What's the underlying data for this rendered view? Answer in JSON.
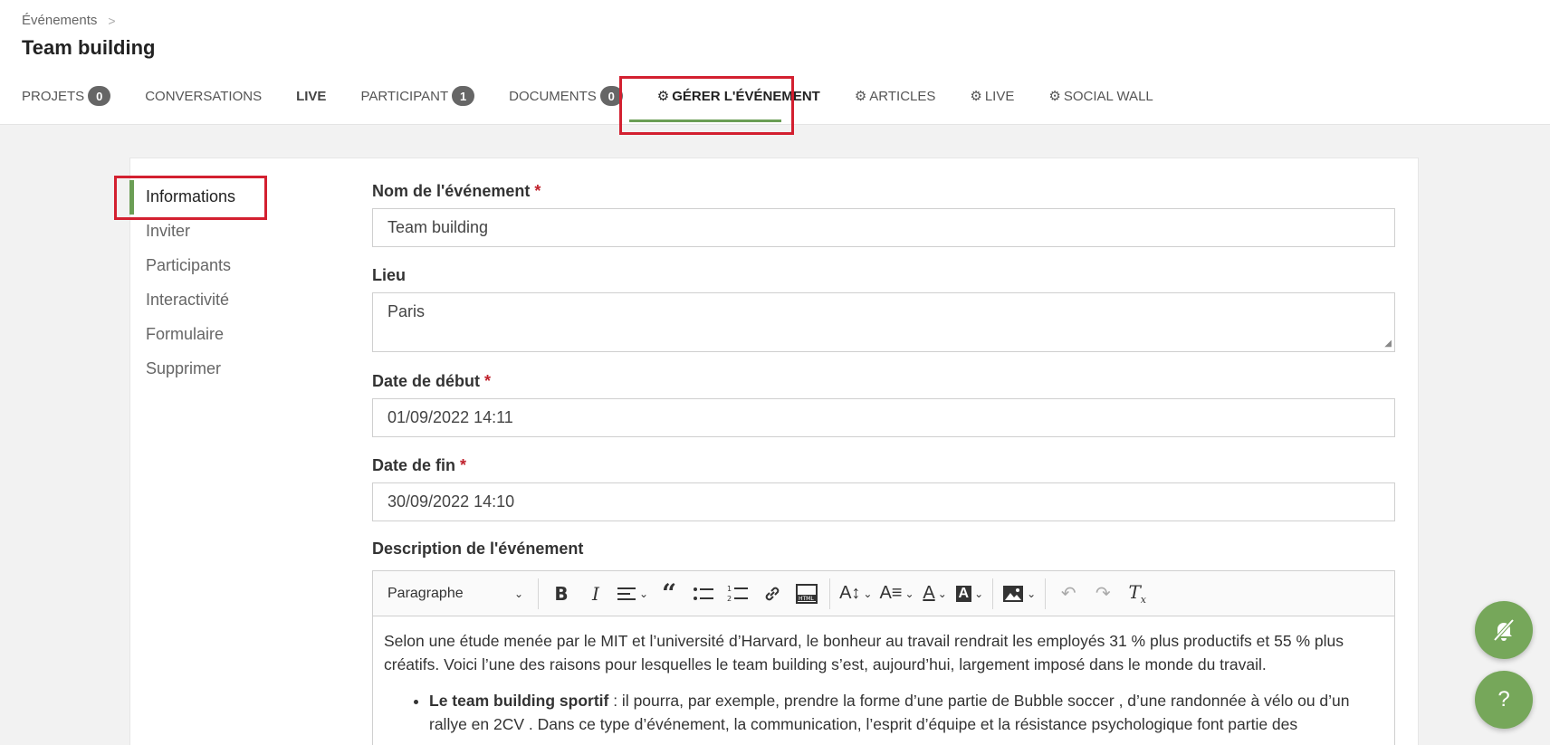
{
  "header": {
    "breadcrumb": "Événements",
    "title": "Team building"
  },
  "tabs": [
    {
      "label": "PROJETS",
      "badge": "0"
    },
    {
      "label": "CONVERSATIONS"
    },
    {
      "label": "LIVE"
    },
    {
      "label": "PARTICIPANT",
      "badge": "1"
    },
    {
      "label": "DOCUMENTS",
      "badge": "0"
    },
    {
      "label": "GÉRER L'ÉVÉNEMENT"
    },
    {
      "label": "ARTICLES"
    },
    {
      "label": "LIVE"
    },
    {
      "label": "SOCIAL WALL"
    }
  ],
  "sidenav": [
    "Informations",
    "Inviter",
    "Participants",
    "Interactivité",
    "Formulaire",
    "Supprimer"
  ],
  "form": {
    "name_label": "Nom de l'événement",
    "name_value": "Team building",
    "location_label": "Lieu",
    "location_value": "Paris",
    "start_label": "Date de début",
    "start_value": "01/09/2022 14:11",
    "end_label": "Date de fin",
    "end_value": "30/09/2022 14:10",
    "desc_label": "Description de l'événement",
    "required_mark": "*"
  },
  "editor": {
    "paragraph_select": "Paragraphe",
    "para1": "Selon une étude menée par le MIT et l’université d’Harvard, le bonheur au travail rendrait les employés 31 % plus productifs et 55 % plus créatifs. Voici l’une des raisons pour lesquelles le team building s’est, aujourd’hui, largement imposé dans le monde du travail.",
    "li1_bold": "Le team building sportif",
    "li1_text": " : il pourra, par exemple, prendre la forme d’une partie de Bubble soccer , d’une randonnée à vélo ou d’un rallye en 2CV . Dans ce type d’événement, la communication, l’esprit d’équipe et la résistance psychologique font partie des"
  },
  "fab": {
    "help": "?"
  },
  "icons": {
    "gear": "⚙",
    "chevron": "›",
    "dropdown": "⌄"
  },
  "colors": {
    "accent": "#6b9e55",
    "highlight": "#d32030",
    "fab": "#76a75a"
  }
}
